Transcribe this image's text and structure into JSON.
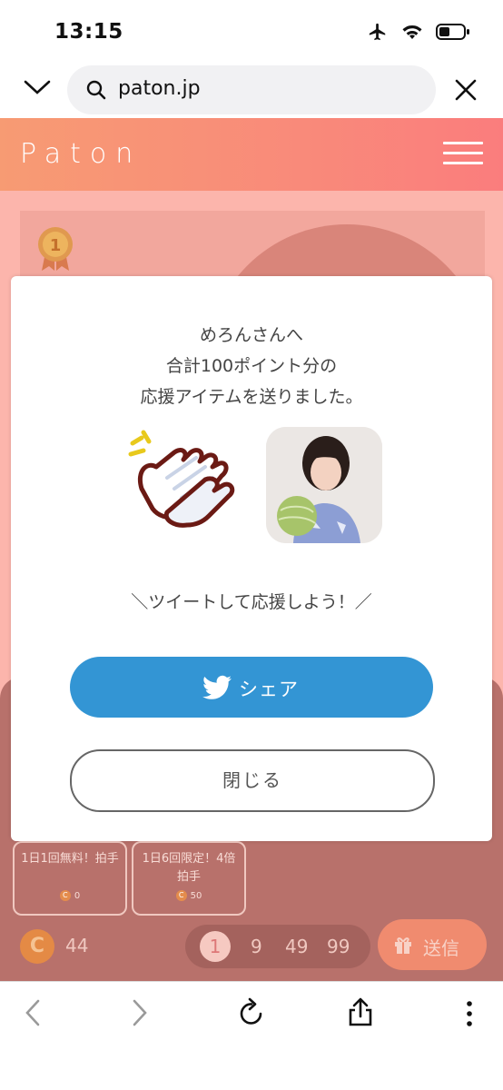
{
  "status_bar": {
    "time": "13:15"
  },
  "browser": {
    "url": "paton.jp"
  },
  "site": {
    "logo": "Paton"
  },
  "rank": {
    "number": "1"
  },
  "background_items": [
    {
      "label": "1日1回無料！拍手",
      "cost": "0"
    },
    {
      "label": "1日6回限定！4倍拍手",
      "cost": "50"
    }
  ],
  "coins": {
    "icon_letter": "C",
    "count": "44"
  },
  "amount_options": [
    "1",
    "9",
    "49",
    "99"
  ],
  "amount_selected": "1",
  "send_button": {
    "label": "送信"
  },
  "modal": {
    "line1": "めろんさんへ",
    "line2": "合計100ポイント分の",
    "line3": "応援アイテムを送りました。",
    "tweet_prompt": "＼ツイートして応援しよう！／",
    "share_label": "シェア",
    "close_label": "閉じる"
  },
  "colors": {
    "header_gradient_start": "#f79b73",
    "header_gradient_end": "#fa7d7d",
    "share_button": "#3395d4",
    "overlay_panel": "#b8716b"
  }
}
